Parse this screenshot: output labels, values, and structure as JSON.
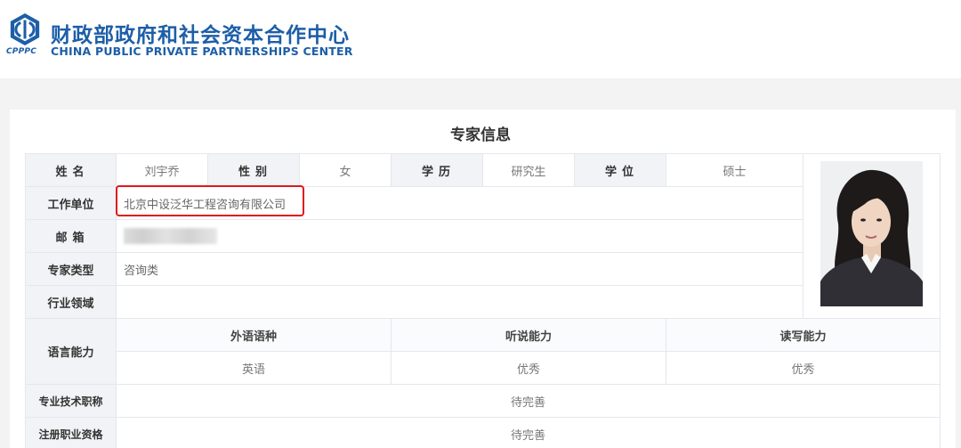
{
  "header": {
    "logo_abbr": "CPPPC",
    "title_cn": "财政部政府和社会资本合作中心",
    "title_en": "CHINA PUBLIC PRIVATE PARTNERSHIPS CENTER"
  },
  "section_title": "专家信息",
  "labels": {
    "name": "姓名",
    "gender": "性别",
    "education": "学历",
    "degree": "学位",
    "work_unit": "工作单位",
    "email": "邮箱",
    "expert_type": "专家类型",
    "industry": "行业领域",
    "language": "语言能力",
    "title": "专业技术职称",
    "qualification": "注册职业资格"
  },
  "values": {
    "name": "刘宇乔",
    "gender": "女",
    "education": "研究生",
    "degree": "硕士",
    "work_unit": "北京中设泛华工程咨询有限公司",
    "email": "",
    "expert_type": "咨询类",
    "industry": "",
    "title": "待完善",
    "qualification": "待完善"
  },
  "language_table": {
    "headers": [
      "外语语种",
      "听说能力",
      "读写能力"
    ],
    "row": [
      "英语",
      "优秀",
      "优秀"
    ]
  },
  "colors": {
    "brand": "#1d5ea8",
    "highlight": "#e0161c"
  }
}
